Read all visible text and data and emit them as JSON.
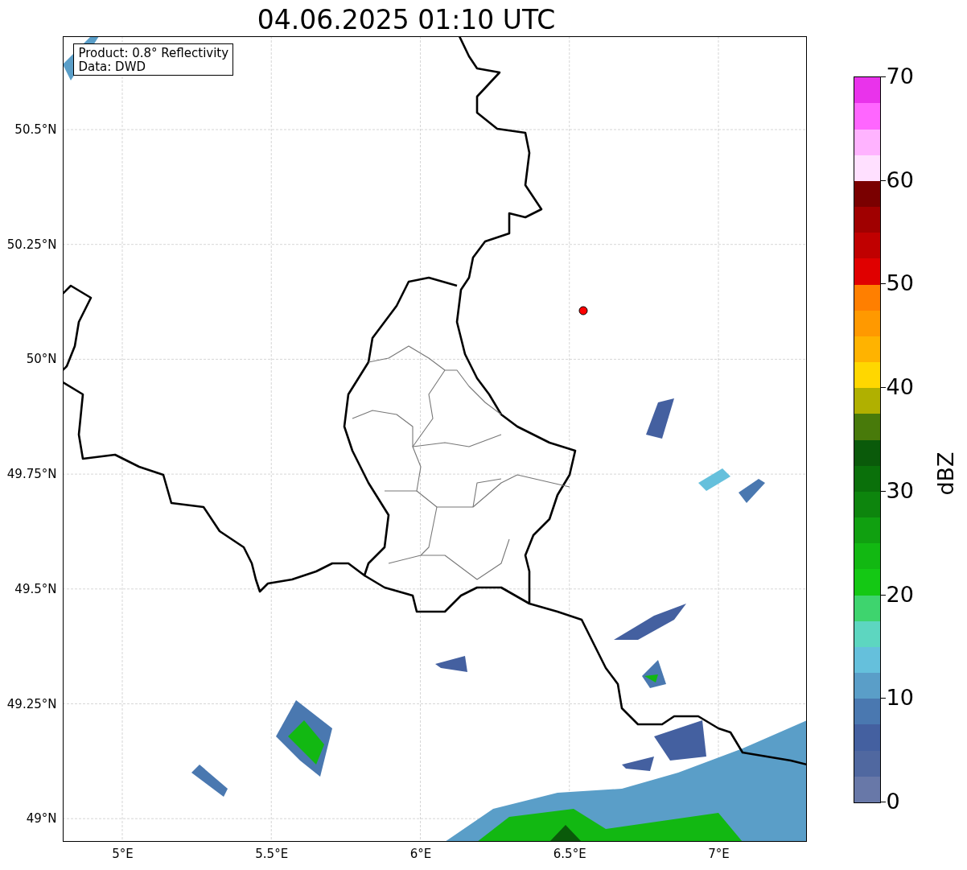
{
  "title": "04.06.2025 01:10 UTC",
  "legend": [
    "Product: 0.8° Reflectivity",
    "Data: DWD"
  ],
  "y_ticks": [
    "50.5°N",
    "50.25°N",
    "50°N",
    "49.75°N",
    "49.5°N",
    "49.25°N",
    "49°N"
  ],
  "x_ticks": [
    "5°E",
    "5.5°E",
    "6°E",
    "6.5°E",
    "7°E"
  ],
  "colorbar": {
    "label": "dBZ",
    "ticks": [
      "70",
      "60",
      "50",
      "40",
      "30",
      "20",
      "10",
      "0"
    ],
    "bands": [
      {
        "color": "#6878a8"
      },
      {
        "color": "#5068a0"
      },
      {
        "color": "#4460a0"
      },
      {
        "color": "#4a78b0"
      },
      {
        "color": "#5a9ec8"
      },
      {
        "color": "#65c0dc"
      },
      {
        "color": "#5dd6c0"
      },
      {
        "color": "#3ed46e"
      },
      {
        "color": "#14c814"
      },
      {
        "color": "#12b812"
      },
      {
        "color": "#10a010"
      },
      {
        "color": "#0d850d"
      },
      {
        "color": "#0a700a"
      },
      {
        "color": "#0a5a0a"
      },
      {
        "color": "#487a0a"
      },
      {
        "color": "#b0b000"
      },
      {
        "color": "#ffd700"
      },
      {
        "color": "#ffb300"
      },
      {
        "color": "#ff9900"
      },
      {
        "color": "#ff7f00"
      },
      {
        "color": "#e00000"
      },
      {
        "color": "#c00000"
      },
      {
        "color": "#a00000"
      },
      {
        "color": "#7a0000"
      },
      {
        "color": "#ffe0ff"
      },
      {
        "color": "#ffb3ff"
      },
      {
        "color": "#ff66ff"
      },
      {
        "color": "#e933eb"
      }
    ]
  }
}
